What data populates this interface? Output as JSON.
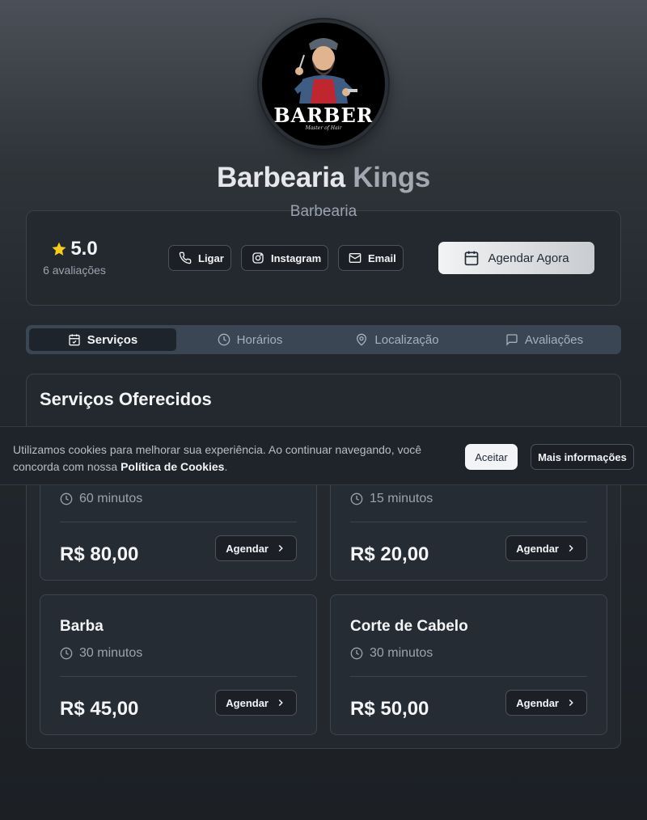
{
  "business": {
    "logo_text": "BARBER",
    "logo_subtext": "Master of Hair",
    "name_word1": "Barbearia",
    "name_word2": "Kings",
    "category": "Barbearia"
  },
  "rating": {
    "score": "5.0",
    "count_label": "6 avaliações"
  },
  "contact": {
    "call_label": "Ligar",
    "instagram_label": "Instagram",
    "email_label": "Email"
  },
  "book_now_label": "Agendar Agora",
  "tabs": [
    {
      "label": "Serviços",
      "icon": "calendar-check-icon",
      "active": true
    },
    {
      "label": "Horários",
      "icon": "clock-icon",
      "active": false
    },
    {
      "label": "Localização",
      "icon": "map-pin-icon",
      "active": false
    },
    {
      "label": "Avaliações",
      "icon": "message-square-icon",
      "active": false
    }
  ],
  "services_title": "Serviços Oferecidos",
  "services": [
    {
      "name": "",
      "duration": "60 minutos",
      "price": "R$ 80,00",
      "button": "Agendar"
    },
    {
      "name": "",
      "duration": "15 minutos",
      "price": "R$ 20,00",
      "button": "Agendar"
    },
    {
      "name": "Barba",
      "duration": "30 minutos",
      "price": "R$ 45,00",
      "button": "Agendar"
    },
    {
      "name": "Corte de Cabelo",
      "duration": "30 minutos",
      "price": "R$ 50,00",
      "button": "Agendar"
    }
  ],
  "cookie": {
    "text": "Utilizamos cookies para melhorar sua experiência. Ao continuar navegando, você concorda com nossa ",
    "link": "Política de Cookies",
    "text_end": ".",
    "accept_label": "Aceitar",
    "more_label": "Mais informações"
  },
  "colors": {
    "star": "#facc15",
    "accent_button": "#f2f3f4",
    "card_bg": "#24292f"
  }
}
